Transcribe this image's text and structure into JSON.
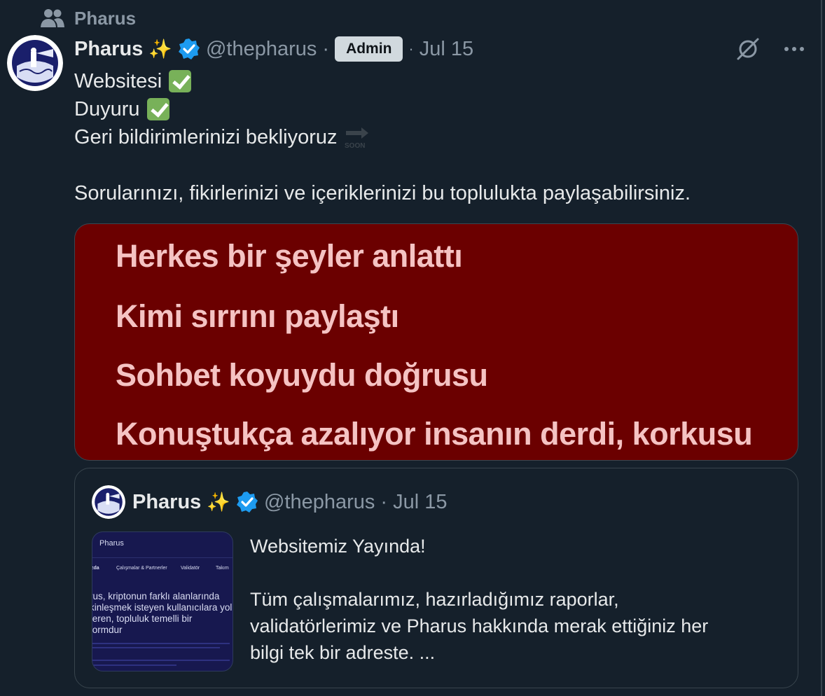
{
  "community": {
    "name": "Pharus",
    "icon": "people-icon"
  },
  "tweet": {
    "author_name": "Pharus",
    "sparkle_emoji": "✨",
    "handle": "@thepharus",
    "separator": "·",
    "badge": "Admin",
    "date": "Jul 15",
    "lines": [
      "Websitesi",
      "Duyuru",
      "Geri bildirimlerinizi bekliyoruz",
      "Sorularınızı, fikirlerinizi ve içeriklerinizi bu toplulukta paylaşabilirsiniz."
    ],
    "soon_label": "SOON",
    "media_lyrics": [
      "Herkes bir şeyler anlattı",
      "Kimi sırrını paylaştı",
      "Sohbet koyuydu doğrusu",
      "Konuştukça azalıyor insanın derdi, korkusu"
    ]
  },
  "quote": {
    "author_name": "Pharus",
    "sparkle_emoji": "✨",
    "handle": "@thepharus",
    "separator": "·",
    "date": "Jul 15",
    "lines": [
      "Websitemiz Yayında!",
      "",
      "Tüm çalışmalarımız, hazırladığımız raporlar,",
      "validatörlerimiz ve Pharus hakkında merak ettiğiniz her",
      "bilgi tek bir adreste. ..."
    ],
    "thumbnail": {
      "site_title": "Pharus",
      "nav": [
        "zda",
        "Çalışmalar & Partnerler",
        "Validatör",
        "Takım"
      ],
      "headline": [
        "rus, kriptonun farklı alanlarında",
        "kinleşmek isteyen kullanıcılara yol",
        "teren, topluluk temelli bir",
        "formdur"
      ]
    }
  },
  "colors": {
    "background": "#15202b",
    "accent_verified": "#1d9bf0",
    "media_bg": "#6b0000",
    "lyric_text": "#f5c3c3"
  }
}
